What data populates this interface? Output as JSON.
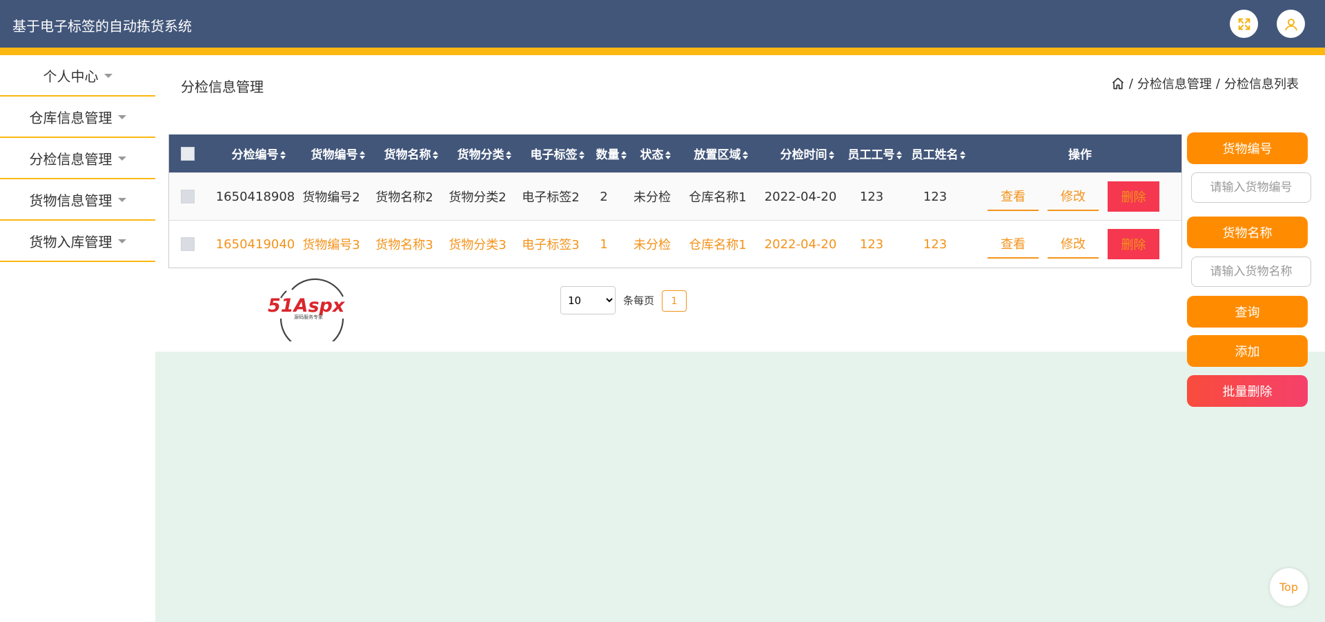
{
  "header": {
    "title": "基于电子标签的自动拣货系统",
    "accent": "#fcb711",
    "bg": "#42567a"
  },
  "sidebar": {
    "items": [
      {
        "label": "个人中心"
      },
      {
        "label": "仓库信息管理"
      },
      {
        "label": "分检信息管理"
      },
      {
        "label": "货物信息管理"
      },
      {
        "label": "货物入库管理"
      }
    ]
  },
  "page": {
    "title": "分检信息管理"
  },
  "breadcrumb": {
    "level1": "分检信息管理",
    "separator": "/",
    "level2": "分检信息列表"
  },
  "table": {
    "columns": [
      "分检编号",
      "货物编号",
      "货物名称",
      "货物分类",
      "电子标签",
      "数量",
      "状态",
      "放置区域",
      "分检时间",
      "员工工号",
      "员工姓名",
      "操作"
    ],
    "rows": [
      [
        "1650418908",
        "货物编号2",
        "货物名称2",
        "货物分类2",
        "电子标签2",
        "2",
        "未分检",
        "仓库名称1",
        "2022-04-20",
        "123",
        "123"
      ],
      [
        "1650419040",
        "货物编号3",
        "货物名称3",
        "货物分类3",
        "电子标签3",
        "1",
        "未分检",
        "仓库名称1",
        "2022-04-20",
        "123",
        "123"
      ]
    ],
    "actions": {
      "view": "查看",
      "edit": "修改",
      "delete": "删除"
    }
  },
  "pagination": {
    "page_size": "10",
    "per_page_label": "条每页",
    "current_page": "1"
  },
  "logo": {
    "text": "51Aspx",
    "subtext": "源码服务专家"
  },
  "search_panel": {
    "field1_label": "货物编号",
    "field1_placeholder": "请输入货物编号",
    "field2_label": "货物名称",
    "field2_placeholder": "请输入货物名称",
    "query": "查询",
    "add": "添加",
    "batch_delete": "批量删除"
  },
  "top_button": "Top"
}
